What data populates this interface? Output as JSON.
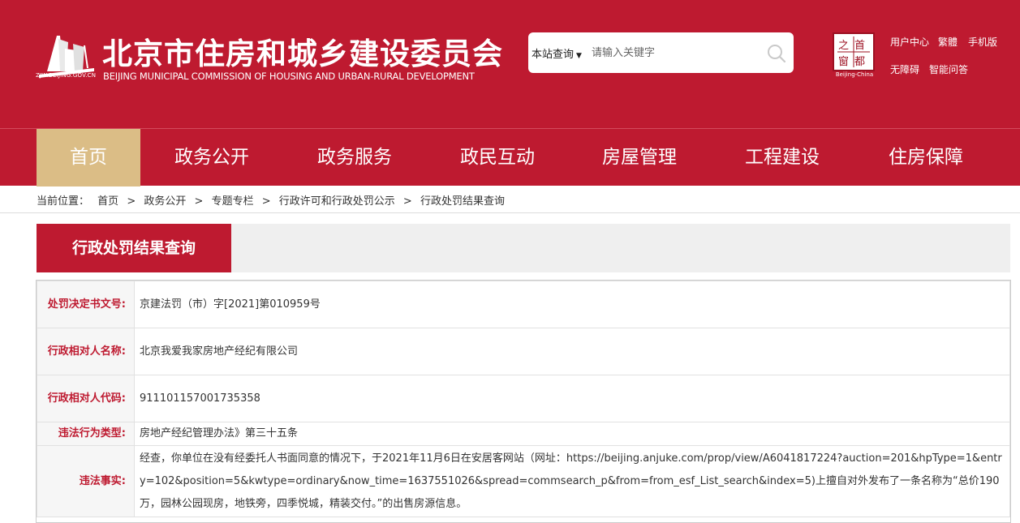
{
  "header": {
    "title": "北京市住房和城乡建设委员会",
    "subtitle": "BEIJING MUNICIPAL COMMISSION OF HOUSING AND URBAN-RURAL DEVELOPMENT",
    "domain": "ZJW.BEIJING.GOV.CN",
    "seal_caption": "Beijing-China",
    "seal_chars": [
      "首",
      "都",
      "之",
      "窗"
    ]
  },
  "search": {
    "scope": "本站查询",
    "placeholder": "请输入关键字"
  },
  "toplinks": [
    "用户中心",
    "繁體",
    "手机版",
    "无障碍",
    "智能问答"
  ],
  "nav": [
    "首页",
    "政务公开",
    "政务服务",
    "政民互动",
    "房屋管理",
    "工程建设",
    "住房保障"
  ],
  "breadcrumb": {
    "label": "当前位置：",
    "items": [
      "首页",
      ">",
      "政务公开",
      ">",
      "专题专栏",
      ">",
      "行政许可和行政处罚公示",
      ">",
      "行政处罚结果查询"
    ]
  },
  "section": {
    "title": "行政处罚结果查询"
  },
  "records": [
    {
      "label": "处罚决定书文号:",
      "value": "京建法罚（市）字[2021]第010959号"
    },
    {
      "label": "行政相对人名称:",
      "value": "北京我爱我家房地产经纪有限公司"
    },
    {
      "label": "行政相对人代码:",
      "value": "911101157001735358"
    },
    {
      "label": "违法行为类型:",
      "value": "房地产经纪管理办法》第三十五条"
    },
    {
      "label": "违法事实:",
      "value": "经查，你单位在没有经委托人书面同意的情况下，于2021年11月6日在安居客网站（网址：https://beijing.anjuke.com/prop/view/A6041817224?auction=201&hpType=1&entry=102&position=5&kwtype=ordinary&now_time=1637551026&spread=commsearch_p&from=from_esf_List_search&index=5)上擅自对外发布了一条名称为“总价190万，园林公园现房，地铁旁，四季悦城，精装交付。”的出售房源信息。"
    }
  ],
  "colors": {
    "brand": "#be1a30",
    "nav_active": "#dbbd86"
  },
  "icons": {
    "search": "search-icon",
    "logo": "logo-icon",
    "seal": "capital-window-seal"
  }
}
